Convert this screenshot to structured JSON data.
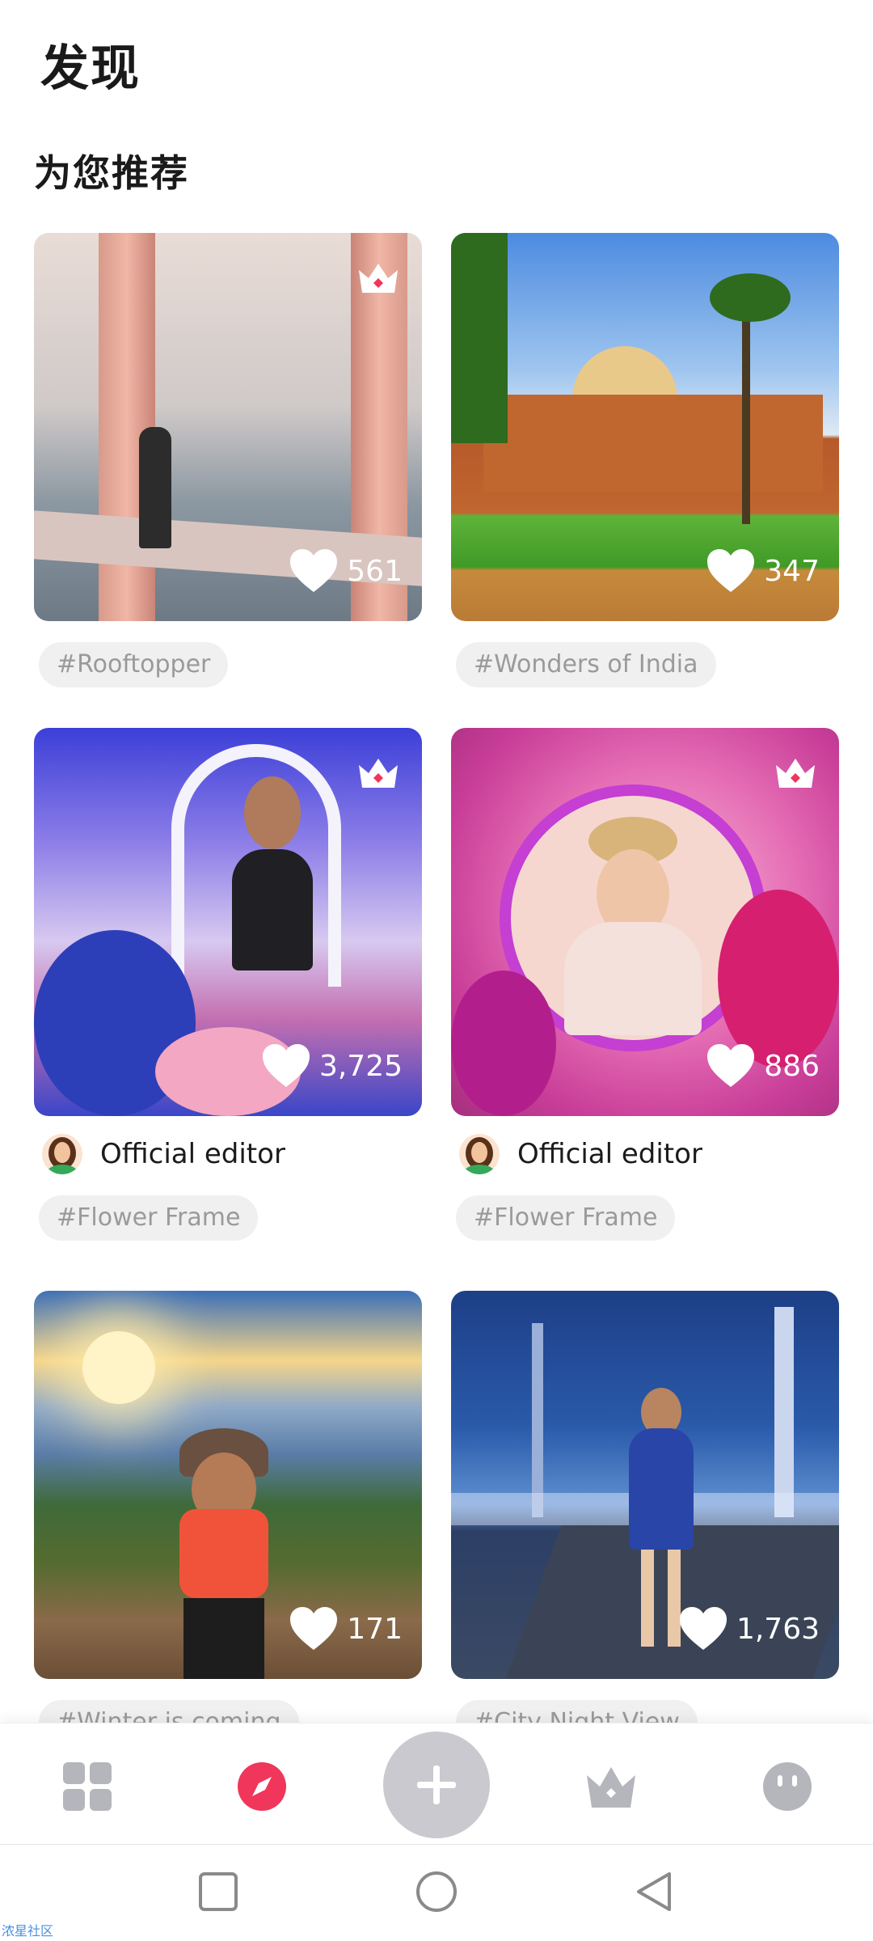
{
  "header": {
    "title": "发现"
  },
  "section": {
    "title": "为您推荐"
  },
  "cards": [
    {
      "likes": "561",
      "tag": "#Rooftopper",
      "premium": true
    },
    {
      "likes": "347",
      "tag": "#Wonders of India",
      "premium": false
    },
    {
      "likes": "3,725",
      "tag": "#Flower Frame",
      "author": "Official editor",
      "premium": true
    },
    {
      "likes": "886",
      "tag": "#Flower Frame",
      "author": "Official editor",
      "premium": true
    },
    {
      "likes": "171",
      "tag": "#Winter is coming",
      "premium": false
    },
    {
      "likes": "1,763",
      "tag": "#City Night View",
      "premium": false
    }
  ],
  "bottom_nav": {
    "items": [
      "grid-icon",
      "compass-icon",
      "add-icon",
      "crown-icon",
      "face-icon"
    ],
    "active": "compass-icon",
    "accent": "#f0365a"
  },
  "system_nav": [
    "square-icon",
    "circle-icon",
    "triangle-back-icon"
  ],
  "watermark": "浓星社区"
}
